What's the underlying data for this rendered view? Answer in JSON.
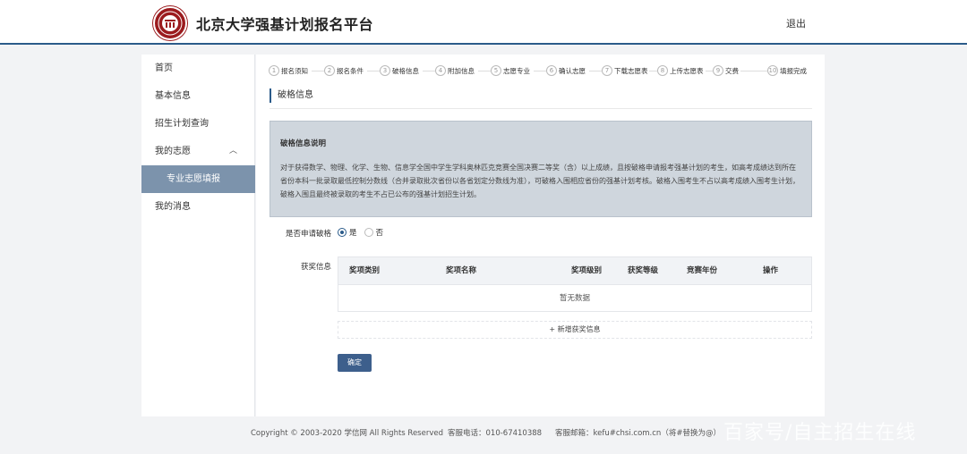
{
  "header": {
    "site_title": "北京大学强基计划报名平台",
    "logout_label": "退出"
  },
  "sidebar": {
    "items": [
      {
        "label": "首页"
      },
      {
        "label": "基本信息"
      },
      {
        "label": "招生计划查询"
      },
      {
        "label": "我的志愿"
      },
      {
        "label": "专业志愿填报"
      },
      {
        "label": "我的消息"
      }
    ]
  },
  "steps": [
    {
      "num": "1",
      "label": "报名须知"
    },
    {
      "num": "2",
      "label": "报名条件"
    },
    {
      "num": "3",
      "label": "破格信息"
    },
    {
      "num": "4",
      "label": "附加信息"
    },
    {
      "num": "5",
      "label": "志愿专业"
    },
    {
      "num": "6",
      "label": "确认志愿"
    },
    {
      "num": "7",
      "label": "下载志愿表"
    },
    {
      "num": "8",
      "label": "上传志愿表"
    },
    {
      "num": "9",
      "label": "交费"
    },
    {
      "num": "10",
      "label": "填报完成"
    }
  ],
  "section_title": "破格信息",
  "notice": {
    "title": "破格信息说明",
    "body": "对于获得数学、物理、化学、生物、信息学全国中学生学科奥林匹克竞赛全国决赛二等奖（含）以上成绩，且按破格申请报考强基计划的考生，如高考成绩达到所在省份本科一批录取最低控制分数线（合并录取批次省份以各省划定分数线为准），可破格入围相应省份的强基计划考核。破格入围考生不占以高考成绩入围考生计划，破格入围且最终被录取的考生不占已公布的强基计划招生计划。"
  },
  "form": {
    "apply_label": "是否申请破格",
    "yes_label": "是",
    "no_label": "否",
    "selected": "是",
    "awards_label": "获奖信息"
  },
  "table": {
    "columns": [
      "奖项类别",
      "奖项名称",
      "奖项级别",
      "获奖等级",
      "竞赛年份",
      "操作"
    ],
    "empty_text": "暂无数据"
  },
  "add_award_label": "+ 新增获奖信息",
  "confirm_label": "确定",
  "footer": {
    "copyright": "Copyright © 2003-2020 学信网 All Rights Reserved",
    "phone": "客服电话：010-67410388",
    "email": "客服邮箱：kefu#chsi.com.cn（将#替换为@）"
  },
  "watermark": "百家号/自主招生在线",
  "colors": {
    "accent": "#2b5b8a",
    "sidebar_active": "#7c93ac",
    "notice_bg": "#cfd6dd",
    "button": "#3d5f8c",
    "logo": "#9b1b1e"
  }
}
